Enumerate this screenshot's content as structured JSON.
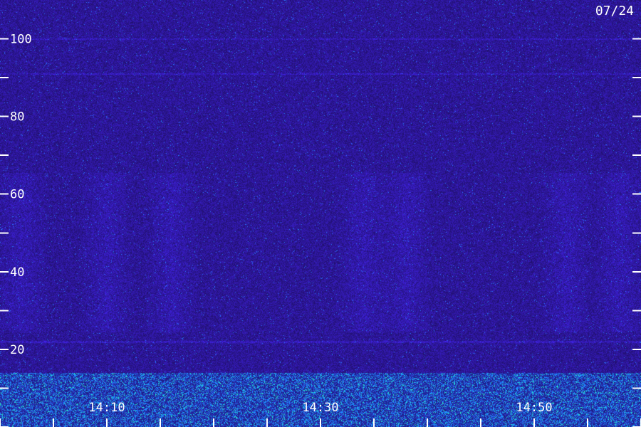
{
  "date_label": "07/24",
  "colors": {
    "background": "#170a4a",
    "noise": "#3a1fcc",
    "band": "#2a8cff",
    "hot": "#1fe0c8",
    "tick": "#ffffff"
  },
  "chart_data": {
    "type": "heatmap",
    "title": "",
    "xlabel": "",
    "ylabel": "",
    "ylim": [
      0,
      110
    ],
    "xlim": [
      "14:00",
      "15:00"
    ],
    "y_ticks": [
      0,
      10,
      20,
      30,
      40,
      50,
      60,
      70,
      80,
      90,
      100
    ],
    "y_tick_labels": [
      {
        "value": 20,
        "label": "20"
      },
      {
        "value": 40,
        "label": "40"
      },
      {
        "value": 60,
        "label": "60"
      },
      {
        "value": 80,
        "label": "80"
      },
      {
        "value": 100,
        "label": "100"
      }
    ],
    "x_ticks": [
      "14:00",
      "14:05",
      "14:10",
      "14:15",
      "14:20",
      "14:25",
      "14:30",
      "14:35",
      "14:40",
      "14:45",
      "14:50",
      "14:55",
      "15:00"
    ],
    "x_tick_labels": [
      {
        "value": "14:10",
        "label": "14:10"
      },
      {
        "value": "14:30",
        "label": "14:30"
      },
      {
        "value": "14:50",
        "label": "14:50"
      }
    ],
    "horizontal_lines": [
      100,
      91,
      22
    ],
    "vertical_bursts": [
      {
        "center": "14:02",
        "range": [
          30,
          60
        ]
      },
      {
        "center": "14:10",
        "range": [
          30,
          60
        ]
      },
      {
        "center": "14:16",
        "range": [
          30,
          60
        ]
      },
      {
        "center": "14:34",
        "range": [
          30,
          60
        ]
      },
      {
        "center": "14:38",
        "range": [
          30,
          60
        ]
      },
      {
        "center": "14:53",
        "range": [
          30,
          60
        ]
      },
      {
        "center": "14:58",
        "range": [
          30,
          60
        ]
      }
    ],
    "low_band": {
      "range": [
        0,
        14
      ]
    },
    "grid": false,
    "legend": "none"
  }
}
